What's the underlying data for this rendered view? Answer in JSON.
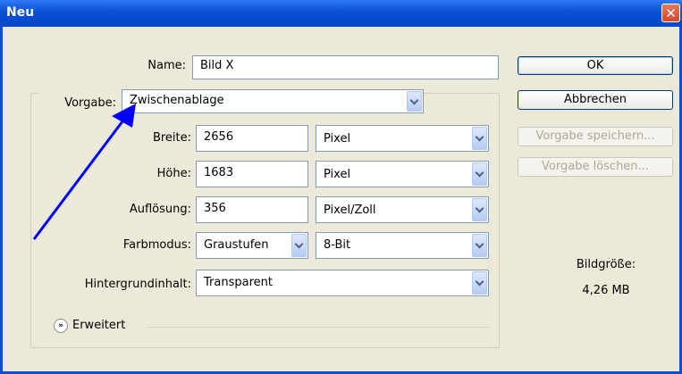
{
  "window": {
    "title": "Neu",
    "close_icon": "close-icon"
  },
  "name": {
    "label": "Name:",
    "value": "Bild X"
  },
  "preset": {
    "label": "Vorgabe:",
    "value": "Zwischenablage"
  },
  "width": {
    "label": "Breite:",
    "value": "2656",
    "unit": "Pixel"
  },
  "height": {
    "label": "Höhe:",
    "value": "1683",
    "unit": "Pixel"
  },
  "resolution": {
    "label": "Auflösung:",
    "value": "356",
    "unit": "Pixel/Zoll"
  },
  "color_mode": {
    "label": "Farbmodus:",
    "value": "Graustufen",
    "depth": "8-Bit"
  },
  "background": {
    "label": "Hintergrundinhalt:",
    "value": "Transparent"
  },
  "advanced": {
    "label": "Erweitert"
  },
  "buttons": {
    "ok": "OK",
    "cancel": "Abbrechen",
    "save_preset": "Vorgabe speichern...",
    "delete_preset": "Vorgabe löschen..."
  },
  "image_size": {
    "label": "Bildgröße:",
    "value": "4,26 MB"
  },
  "annotation": {
    "arrow_color": "#0000ff"
  },
  "colors": {
    "titlebar": "#0a4fd6",
    "dialog_bg": "#ece9d8",
    "close": "#d14a2a"
  }
}
